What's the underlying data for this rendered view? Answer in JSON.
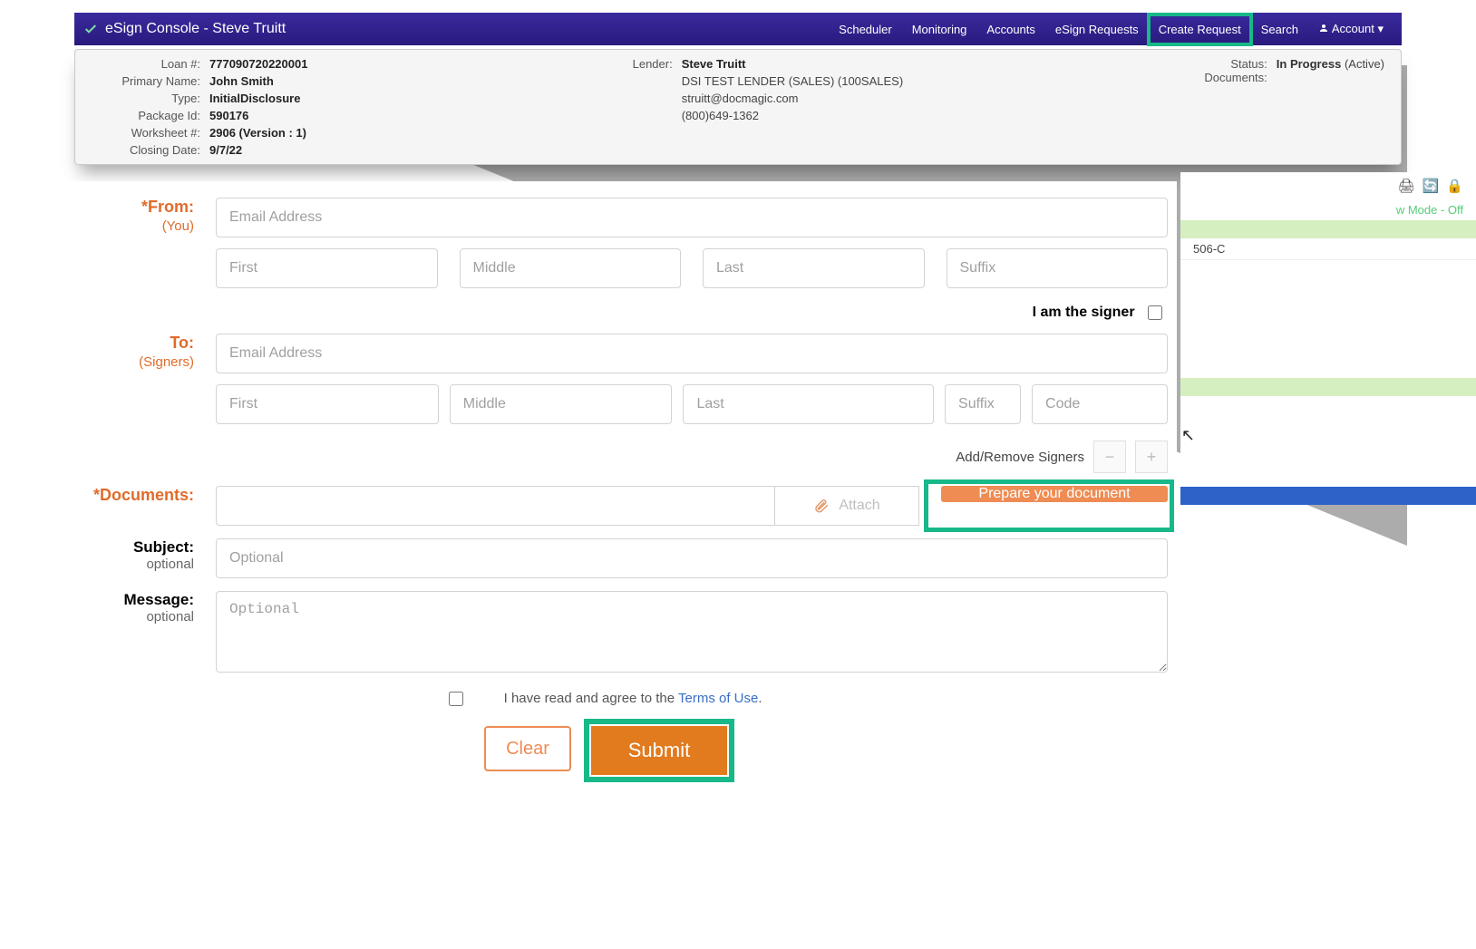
{
  "topbar": {
    "title": "eSign Console - Steve Truitt",
    "nav": [
      "Scheduler",
      "Monitoring",
      "Accounts",
      "eSign Requests",
      "Create Request",
      "Search",
      "Account"
    ]
  },
  "header": {
    "left": {
      "labels": [
        "Loan #:",
        "Primary Name:",
        "Type:",
        "Package Id:",
        "Worksheet #:",
        "Closing Date:"
      ],
      "values": [
        "777090720220001",
        "John Smith",
        "InitialDisclosure",
        "590176",
        "2906 (Version : 1)",
        "9/7/22"
      ]
    },
    "center": {
      "label": "Lender:",
      "name": "Steve Truitt",
      "company": "DSI TEST LENDER (SALES) (100SALES)",
      "email": "struitt@docmagic.com",
      "phone": "(800)649-1362"
    },
    "right": {
      "statusLabel": "Status:",
      "statusValue": "In Progress",
      "statusSub": "(Active)",
      "documentsLabel": "Documents:"
    }
  },
  "form": {
    "fromLabel": "*From:",
    "fromSub": "(You)",
    "emailPlaceholder": "Email Address",
    "first": "First",
    "middle": "Middle",
    "last": "Last",
    "suffix": "Suffix",
    "iAmSigner": "I am the signer",
    "toLabel": "To:",
    "toSub": "(Signers)",
    "code": "Code",
    "addRemove": "Add/Remove Signers",
    "documentsLabel": "*Documents:",
    "attach": "Attach",
    "prepare": "Prepare your document",
    "subjectLabel": "Subject:",
    "optional": "optional",
    "optionalPh": "Optional",
    "messageLabel": "Message:",
    "termsPre": "I have read and agree to the ",
    "termsLink": "Terms of Use",
    "clear": "Clear",
    "submit": "Submit"
  },
  "side": {
    "mode": "w Mode - Off",
    "line1": "506-C"
  }
}
